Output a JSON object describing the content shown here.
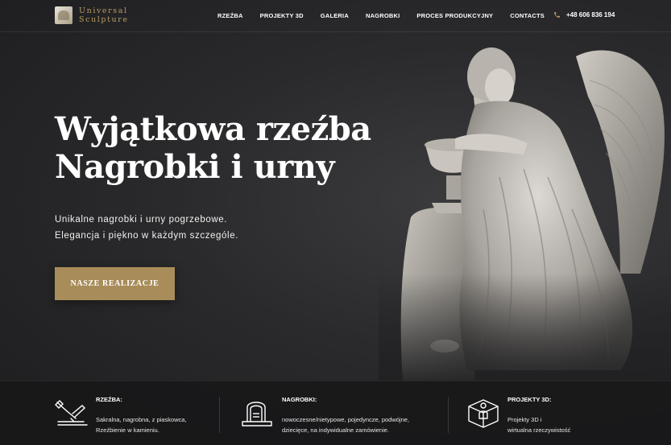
{
  "header": {
    "logo_line1": "Universal",
    "logo_line2": "Sculpture",
    "nav": [
      "RZEŹBA",
      "PROJEKTY 3D",
      "GALERIA",
      "NAGROBKI",
      "PROCES PRODUKCYJNY",
      "CONTACTS"
    ],
    "phone": "+48 606 836 194",
    "phone_icon": "phone-icon"
  },
  "hero": {
    "title_line1": "Wyjątkowa rzeźba",
    "title_line2": "Nagrobki i urny",
    "subtitle_line1": "Unikalne nagrobki i urny pogrzebowe.",
    "subtitle_line2": "Elegancja i piękno w każdym szczególe.",
    "cta_label": "NASZE REALIZACJE",
    "image": "angel-statue"
  },
  "features": [
    {
      "icon": "chisel-icon",
      "title": "RZEŹBA:",
      "desc_line1": "Sakralna, nagrobna, z piaskowca,",
      "desc_line2": "Rzeźbienie w kamieniu."
    },
    {
      "icon": "tombstone-icon",
      "title": "NAGROBKI:",
      "desc_line1": "nowoczesne/nietypowe, pojedyncze, podwójne,",
      "desc_line2": "dziecięce, na indywidualne zamówienie."
    },
    {
      "icon": "3d-cube-icon",
      "title": "PROJEKTY 3D:",
      "desc_line1": "Projekty 3D i",
      "desc_line2": "wirtualna rzeczywistość"
    }
  ],
  "colors": {
    "accent": "#a88d5a",
    "logo_gold": "#b99d63",
    "background": "#2a2a2c",
    "feature_bar": "#181819"
  }
}
